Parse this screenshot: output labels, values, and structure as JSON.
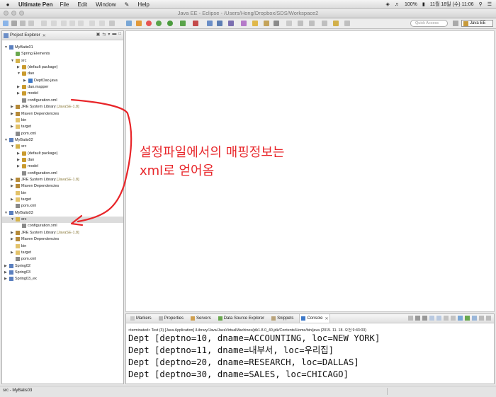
{
  "menubar": {
    "apple": "",
    "app": "Ultimate Pen",
    "items": [
      "File",
      "Edit",
      "Window",
      "Help"
    ],
    "battery": "100%",
    "datetime": "11월 18일 (수) 11:06"
  },
  "window": {
    "title": "Java EE - Eclipse - /Users/Hong/Dropbox/SDS/Workspace2"
  },
  "toolbar": {
    "quick_access_placeholder": "Quick Access",
    "perspective": "Java EE"
  },
  "project_explorer": {
    "title": "Project Explorer",
    "tree": [
      {
        "label": "MyBatis01",
        "depth": 0,
        "twisty": "open",
        "icon": "project"
      },
      {
        "label": "Spring Elements",
        "depth": 1,
        "twisty": "",
        "icon": "spring"
      },
      {
        "label": "src",
        "depth": 1,
        "twisty": "open",
        "icon": "srcfolder"
      },
      {
        "label": "(default package)",
        "depth": 2,
        "twisty": "closed",
        "icon": "package"
      },
      {
        "label": "dao",
        "depth": 2,
        "twisty": "open",
        "icon": "package"
      },
      {
        "label": "DeptDao.java",
        "depth": 3,
        "twisty": "closed",
        "icon": "javafile"
      },
      {
        "label": "dao.mapper",
        "depth": 2,
        "twisty": "closed",
        "icon": "package"
      },
      {
        "label": "model",
        "depth": 2,
        "twisty": "closed",
        "icon": "package"
      },
      {
        "label": "configuration.xml",
        "depth": 2,
        "twisty": "",
        "icon": "xmlfile"
      },
      {
        "label": "JRE System Library",
        "decoration": "[JavaSE-1.8]",
        "depth": 1,
        "twisty": "closed",
        "icon": "library"
      },
      {
        "label": "Maven Dependencies",
        "depth": 1,
        "twisty": "closed",
        "icon": "library"
      },
      {
        "label": "bin",
        "depth": 1,
        "twisty": "",
        "icon": "folder"
      },
      {
        "label": "target",
        "depth": 1,
        "twisty": "closed",
        "icon": "folder"
      },
      {
        "label": "pom.xml",
        "depth": 1,
        "twisty": "",
        "icon": "xmlfile"
      },
      {
        "label": "MyBatis02",
        "depth": 0,
        "twisty": "open",
        "icon": "project"
      },
      {
        "label": "src",
        "depth": 1,
        "twisty": "open",
        "icon": "srcfolder"
      },
      {
        "label": "(default package)",
        "depth": 2,
        "twisty": "closed",
        "icon": "package"
      },
      {
        "label": "dao",
        "depth": 2,
        "twisty": "closed",
        "icon": "package"
      },
      {
        "label": "model",
        "depth": 2,
        "twisty": "closed",
        "icon": "package"
      },
      {
        "label": "configuration.xml",
        "depth": 2,
        "twisty": "",
        "icon": "xmlfile"
      },
      {
        "label": "JRE System Library",
        "decoration": "[JavaSE-1.8]",
        "depth": 1,
        "twisty": "closed",
        "icon": "library"
      },
      {
        "label": "Maven Dependencies",
        "depth": 1,
        "twisty": "closed",
        "icon": "library"
      },
      {
        "label": "bin",
        "depth": 1,
        "twisty": "",
        "icon": "folder"
      },
      {
        "label": "target",
        "depth": 1,
        "twisty": "closed",
        "icon": "folder"
      },
      {
        "label": "pom.xml",
        "depth": 1,
        "twisty": "",
        "icon": "xmlfile"
      },
      {
        "label": "MyBatis03",
        "depth": 0,
        "twisty": "open",
        "icon": "project"
      },
      {
        "label": "src",
        "depth": 1,
        "twisty": "open",
        "icon": "srcfolder",
        "selected": true
      },
      {
        "label": "configuration.xml",
        "depth": 2,
        "twisty": "",
        "icon": "xmlfile"
      },
      {
        "label": "JRE System Library",
        "decoration": "[JavaSE-1.8]",
        "depth": 1,
        "twisty": "closed",
        "icon": "library"
      },
      {
        "label": "Maven Dependencies",
        "depth": 1,
        "twisty": "closed",
        "icon": "library"
      },
      {
        "label": "bin",
        "depth": 1,
        "twisty": "",
        "icon": "folder"
      },
      {
        "label": "target",
        "depth": 1,
        "twisty": "closed",
        "icon": "folder"
      },
      {
        "label": "pom.xml",
        "depth": 1,
        "twisty": "",
        "icon": "xmlfile"
      },
      {
        "label": "Spring02",
        "depth": 0,
        "twisty": "closed",
        "icon": "project"
      },
      {
        "label": "Spring03",
        "depth": 0,
        "twisty": "closed",
        "icon": "project"
      },
      {
        "label": "Spring03_ex",
        "depth": 0,
        "twisty": "closed",
        "icon": "project"
      }
    ]
  },
  "bottom_panel": {
    "tabs": [
      {
        "label": "Markers",
        "icon": "markers"
      },
      {
        "label": "Properties",
        "icon": "properties"
      },
      {
        "label": "Servers",
        "icon": "servers"
      },
      {
        "label": "Data Source Explorer",
        "icon": "datasource"
      },
      {
        "label": "Snippets",
        "icon": "snippets"
      },
      {
        "label": "Console",
        "icon": "console",
        "active": true
      }
    ],
    "terminated": "<terminated> Test (3) [Java Application] /Library/Java/JavaVirtualMachines/jdk1.8.0_40.jdk/Contents/Home/bin/java (2015. 11. 18. 오전 9:43:03)",
    "console_lines": [
      "Dept [deptno=10, dname=ACCOUNTING, loc=NEW YORK]",
      "Dept [deptno=11, dname=내부서, loc=우리집]",
      "Dept [deptno=20, dname=RESEARCH, loc=DALLAS]",
      "Dept [deptno=30, dname=SALES, loc=CHICAGO]"
    ]
  },
  "statusbar": {
    "text": "src - MyBatis03"
  },
  "annotation": {
    "line1": "설정파일에서의 매핑정보는",
    "line2": "xml로 얻어옴",
    "color": "#e8262a"
  },
  "icon_colors": {
    "project": "#5a7fbf",
    "package": "#c99a2e",
    "srcfolder": "#d4b24a",
    "folder": "#e3c26a",
    "javafile": "#3c78c8",
    "xmlfile": "#8a8a8a",
    "library": "#b58a3a",
    "spring": "#6aa84f"
  }
}
